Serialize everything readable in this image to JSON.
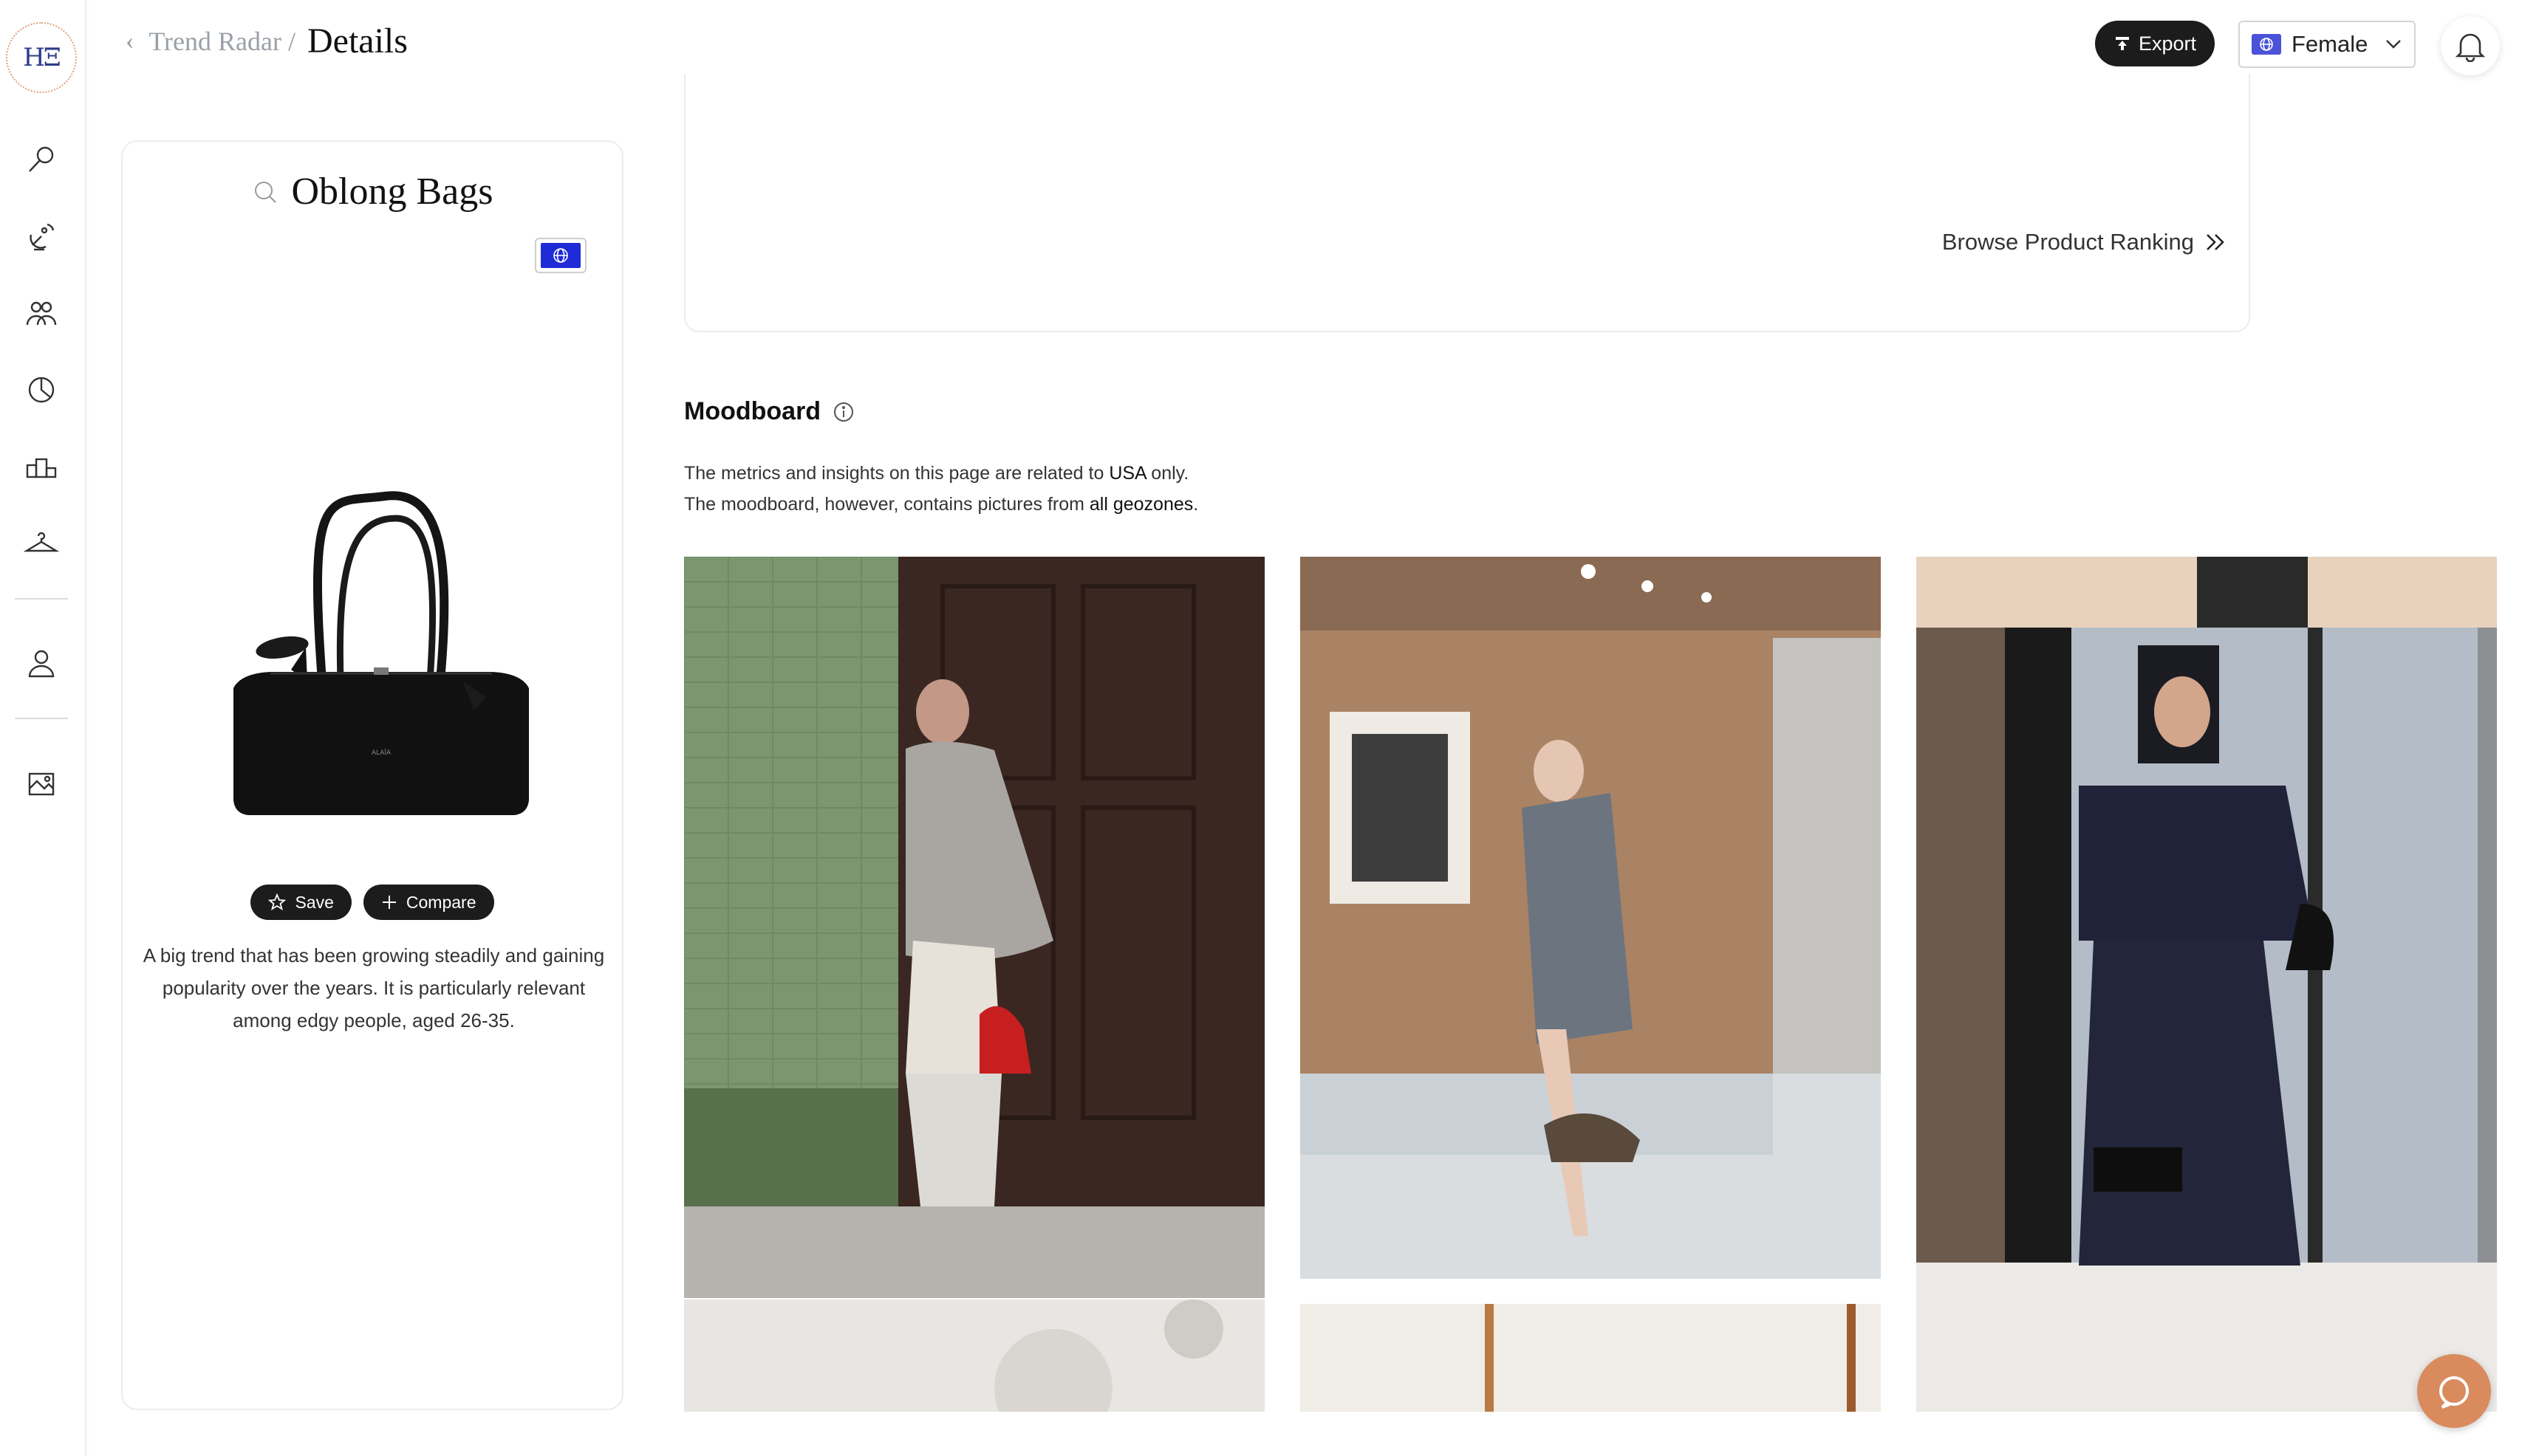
{
  "breadcrumb": {
    "parent": "Trend Radar /",
    "current": "Details"
  },
  "header": {
    "export_label": "Export",
    "gender_value": "Female"
  },
  "sidebar": {
    "logo_text": "HΞ",
    "items": [
      "search-icon",
      "radar-icon",
      "community-icon",
      "pie-chart-icon",
      "podium-icon",
      "hanger-icon",
      "profile-icon",
      "moodboard-icon"
    ]
  },
  "trend": {
    "title": "Oblong Bags",
    "save_label": "Save",
    "compare_label": "Compare",
    "description": "A big trend that has been growing steadily and gaining popularity over the years. It is particularly relevant among edgy people, aged 26-35."
  },
  "panel": {
    "browse_label": "Browse Product Ranking"
  },
  "moodboard": {
    "title": "Moodboard",
    "note_line1_pre": "The metrics and insights on this page are related to ",
    "note_line1_bold": "USA",
    "note_line1_post": " only.",
    "note_line2_pre": "The moodboard, however, contains pictures from ",
    "note_line2_bold": "all geozones",
    "note_line2_post": ".",
    "photos": [
      "street-style-red-bag-photo",
      "grey-blazer-brown-bag-photo",
      "navy-outfit-black-bag-photo"
    ]
  },
  "colors": {
    "accent": "#1c1c1c",
    "globe_blue": "#1f2bd6",
    "chat": "#d98b5e",
    "logo": "#2d3b8a"
  }
}
